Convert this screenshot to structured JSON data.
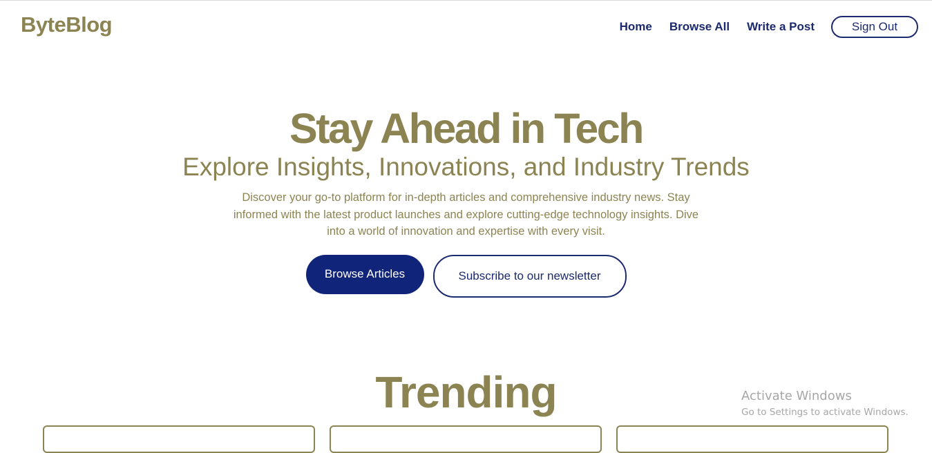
{
  "navbar": {
    "logo": "ByteBlog",
    "links": [
      {
        "label": "Home"
      },
      {
        "label": "Browse All"
      },
      {
        "label": "Write a Post"
      }
    ],
    "signout_label": "Sign Out"
  },
  "hero": {
    "title": "Stay Ahead in Tech",
    "subtitle": "Explore Insights, Innovations, and Industry Trends",
    "description": "Discover your go-to platform for in-depth articles and comprehensive industry news. Stay informed with the latest product launches and explore cutting-edge technology insights. Dive into a world of innovation and expertise with every visit.",
    "primary_button": "Browse Articles",
    "secondary_button": "Subscribe to our newsletter"
  },
  "trending": {
    "title": "Trending"
  },
  "watermark": {
    "title": "Activate Windows",
    "subtitle": "Go to Settings to activate Windows."
  },
  "colors": {
    "brand_olive": "#8b8452",
    "navy": "#1b2a6e",
    "primary_button_bg": "#10247a"
  }
}
